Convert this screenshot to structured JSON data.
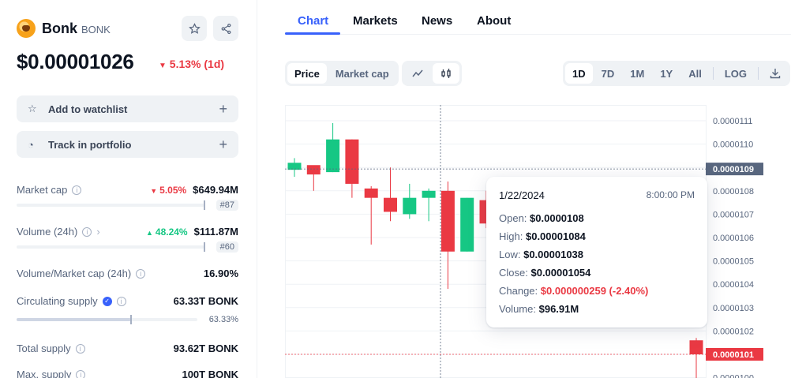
{
  "coin": {
    "name": "Bonk",
    "symbol": "BONK",
    "price": "$0.00001026",
    "change_1d": "5.13% (1d)"
  },
  "actions": {
    "watchlist": "Add to watchlist",
    "portfolio": "Track in portfolio"
  },
  "stats": {
    "market_cap": {
      "label": "Market cap",
      "change": "5.05%",
      "value": "$649.94M",
      "rank": "#87"
    },
    "volume": {
      "label": "Volume (24h)",
      "change": "48.24%",
      "value": "$111.87M",
      "rank": "#60"
    },
    "vol_mcap": {
      "label": "Volume/Market cap (24h)",
      "value": "16.90%"
    },
    "circulating": {
      "label": "Circulating supply",
      "value": "63.33T BONK",
      "pct": "63.33%",
      "fill": 0.6333
    },
    "total": {
      "label": "Total supply",
      "value": "93.62T BONK"
    },
    "max": {
      "label": "Max. supply",
      "value": "100T BONK"
    }
  },
  "tabs": [
    "Chart",
    "Markets",
    "News",
    "About"
  ],
  "toggles": {
    "price": "Price",
    "market_cap": "Market cap"
  },
  "ranges": [
    "1D",
    "7D",
    "1M",
    "1Y",
    "All"
  ],
  "log_label": "LOG",
  "colors": {
    "up": "#16c784",
    "down": "#ea3943",
    "accent": "#3861fb"
  },
  "tooltip": {
    "date": "1/22/2024",
    "time": "8:00:00 PM",
    "open_label": "Open:",
    "open": "$0.0000108",
    "high_label": "High:",
    "high": "$0.00001084",
    "low_label": "Low:",
    "low": "$0.00001038",
    "close_label": "Close:",
    "close": "$0.00001054",
    "change_label": "Change:",
    "change": "$0.000000259 (-2.40%)",
    "volume_label": "Volume:",
    "volume": "$96.91M"
  },
  "chart_data": {
    "type": "candlestick",
    "y_ticks": [
      "0.0000111",
      "0.0000110",
      "0.0000109",
      "0.0000108",
      "0.0000107",
      "0.0000106",
      "0.0000105",
      "0.0000104",
      "0.0000103",
      "0.0000102",
      "0.0000101",
      "0.0000100"
    ],
    "y_tick_values": [
      1.11e-05,
      1.1e-05,
      1.09e-05,
      1.08e-05,
      1.07e-05,
      1.06e-05,
      1.05e-05,
      1.04e-05,
      1.03e-05,
      1.02e-05,
      1.01e-05,
      1e-05
    ],
    "crosshair_label": "0.0000109",
    "current_label": "0.0000101",
    "candles": [
      {
        "o": 1.089e-05,
        "h": 1.094e-05,
        "l": 1.086e-05,
        "c": 1.092e-05
      },
      {
        "o": 1.091e-05,
        "h": 1.089e-05,
        "l": 1.08e-05,
        "c": 1.087e-05
      },
      {
        "o": 1.088e-05,
        "h": 1.109e-05,
        "l": 1.088e-05,
        "c": 1.102e-05
      },
      {
        "o": 1.102e-05,
        "h": 1.102e-05,
        "l": 1.077e-05,
        "c": 1.083e-05
      },
      {
        "o": 1.081e-05,
        "h": 1.082e-05,
        "l": 1.057e-05,
        "c": 1.077e-05
      },
      {
        "o": 1.077e-05,
        "h": 1.09e-05,
        "l": 1.067e-05,
        "c": 1.071e-05
      },
      {
        "o": 1.07e-05,
        "h": 1.083e-05,
        "l": 1.068e-05,
        "c": 1.077e-05
      },
      {
        "o": 1.077e-05,
        "h": 1.081e-05,
        "l": 1.067e-05,
        "c": 1.08e-05
      },
      {
        "o": 1.08e-05,
        "h": 1.084e-05,
        "l": 1.038e-05,
        "c": 1.054e-05
      },
      {
        "o": 1.054e-05,
        "h": 1.077e-05,
        "l": 1.054e-05,
        "c": 1.077e-05
      },
      {
        "o": 1.076e-05,
        "h": 1.08e-05,
        "l": 1.064e-05,
        "c": 1.066e-05
      },
      {
        "o": 1.016e-05,
        "h": 1.017e-05,
        "l": 9.9e-06,
        "c": 1.01e-05
      }
    ]
  }
}
